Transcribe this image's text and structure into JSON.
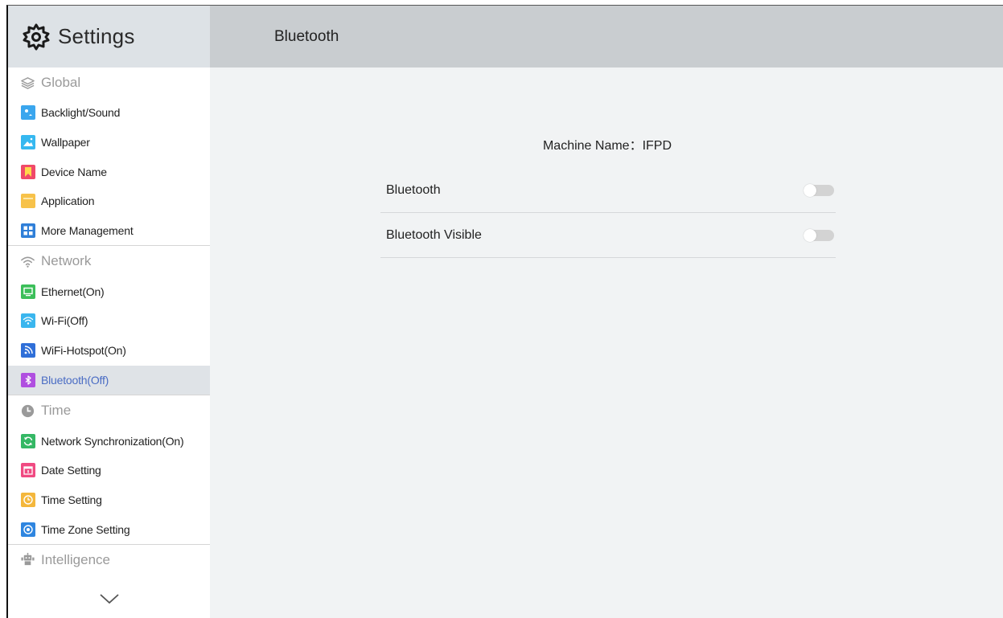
{
  "app": {
    "title": "Settings"
  },
  "page": {
    "title": "Bluetooth"
  },
  "sidebar": {
    "groups": [
      {
        "label": "Global",
        "icon": "layers-icon",
        "items": [
          {
            "label": "Backlight/Sound",
            "icon": "backlight-icon",
            "color": "#3aa6ee"
          },
          {
            "label": "Wallpaper",
            "icon": "wallpaper-icon",
            "color": "#36b8f0"
          },
          {
            "label": "Device Name",
            "icon": "bookmark-icon",
            "color": "#f04a6a"
          },
          {
            "label": "Application",
            "icon": "folder-icon",
            "color": "#f7c24a"
          },
          {
            "label": "More Management",
            "icon": "grid-icon",
            "color": "#2f7fd8"
          }
        ]
      },
      {
        "label": "Network",
        "icon": "wifi-icon",
        "items": [
          {
            "label": "Ethernet(On)",
            "icon": "monitor-icon",
            "color": "#3cbf5a"
          },
          {
            "label": "Wi-Fi(Off)",
            "icon": "wifi-icon",
            "color": "#3ab6ee"
          },
          {
            "label": "WiFi-Hotspot(On)",
            "icon": "hotspot-icon",
            "color": "#2f6fd8"
          },
          {
            "label": "Bluetooth(Off)",
            "icon": "bluetooth-icon",
            "color": "#b04fe0",
            "active": true
          }
        ]
      },
      {
        "label": "Time",
        "icon": "clock-icon",
        "items": [
          {
            "label": "Network Synchronization(On)",
            "icon": "sync-icon",
            "color": "#35b865"
          },
          {
            "label": "Date Setting",
            "icon": "calendar-icon",
            "color": "#f04a82"
          },
          {
            "label": "Time Setting",
            "icon": "clock-icon",
            "color": "#f4b73c"
          },
          {
            "label": "Time Zone Setting",
            "icon": "timezone-icon",
            "color": "#2f86e0"
          }
        ]
      },
      {
        "label": "Intelligence",
        "icon": "robot-icon",
        "items": []
      }
    ],
    "more_icon": "chevron-down-icon"
  },
  "main": {
    "machine_name_label": "Machine Name：",
    "machine_name_value": "IFPD",
    "settings": [
      {
        "label": "Bluetooth",
        "state": "off"
      },
      {
        "label": "Bluetooth Visible",
        "state": "off"
      }
    ]
  }
}
